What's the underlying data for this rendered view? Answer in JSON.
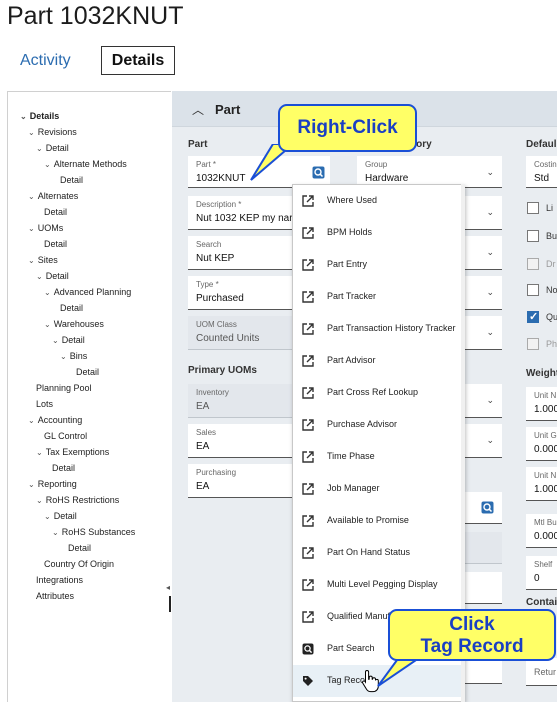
{
  "header": {
    "title": "Part 1032KNUT"
  },
  "tabs": [
    {
      "label": "Activity"
    },
    {
      "label": "Details"
    }
  ],
  "tree": [
    {
      "label": "Details"
    },
    {
      "label": "Revisions"
    },
    {
      "label": "Detail"
    },
    {
      "label": "Alternate Methods"
    },
    {
      "label": "Detail"
    },
    {
      "label": "Alternates"
    },
    {
      "label": "Detail"
    },
    {
      "label": "UOMs"
    },
    {
      "label": "Detail"
    },
    {
      "label": "Sites"
    },
    {
      "label": "Detail"
    },
    {
      "label": "Advanced Planning"
    },
    {
      "label": "Detail"
    },
    {
      "label": "Warehouses"
    },
    {
      "label": "Detail"
    },
    {
      "label": "Bins"
    },
    {
      "label": "Detail"
    },
    {
      "label": "Planning Pool"
    },
    {
      "label": "Lots"
    },
    {
      "label": "Accounting"
    },
    {
      "label": "GL Control"
    },
    {
      "label": "Tax Exemptions"
    },
    {
      "label": "Detail"
    },
    {
      "label": "Reporting"
    },
    {
      "label": "RoHS Restrictions"
    },
    {
      "label": "Detail"
    },
    {
      "label": "RoHS Substances"
    },
    {
      "label": "Detail"
    },
    {
      "label": "Country Of Origin"
    },
    {
      "label": "Integrations"
    },
    {
      "label": "Attributes"
    }
  ],
  "section": {
    "title": "Part",
    "part_group": "Part",
    "category_group": "gory",
    "defaults_group": "Defaul",
    "primary_uoms_group": "Primary UOMs",
    "weight_group": "Weight",
    "container_group": "Contai"
  },
  "fields": {
    "part": {
      "label": "Part *",
      "value": "1032KNUT"
    },
    "description": {
      "label": "Description *",
      "value": "Nut 1032 KEP my nar"
    },
    "search": {
      "label": "Search",
      "value": "Nut KEP"
    },
    "type": {
      "label": "Type *",
      "value": "Purchased"
    },
    "uom_class": {
      "label": "UOM Class",
      "value": "Counted Units"
    },
    "inventory": {
      "label": "Inventory",
      "value": "EA"
    },
    "sales": {
      "label": "Sales",
      "value": "EA"
    },
    "purchasing": {
      "label": "Purchasing",
      "value": "EA"
    },
    "group": {
      "label": "Group",
      "value": "Hardware"
    },
    "costing": {
      "label": "Costin",
      "value": "Std"
    },
    "unit1": {
      "label": "Unit N",
      "value": "1.000"
    },
    "unit2": {
      "label": "Unit G",
      "value": "0.000"
    },
    "unit3": {
      "label": "Unit N",
      "value": "1.000"
    },
    "mtl_bu": {
      "label": "Mtl Bu",
      "value": "0.000"
    },
    "shelf": {
      "label": "Shelf",
      "value": "0"
    },
    "return": {
      "label": "Retur",
      "value": ""
    }
  },
  "checkboxes": [
    {
      "label": "Li",
      "checked": false,
      "disabled": false
    },
    {
      "label": "Bu",
      "checked": false,
      "disabled": false
    },
    {
      "label": "Dr",
      "checked": false,
      "disabled": true
    },
    {
      "label": "No",
      "checked": false,
      "disabled": false
    },
    {
      "label": "Qu",
      "checked": true,
      "disabled": false
    },
    {
      "label": "Ph",
      "checked": false,
      "disabled": true
    }
  ],
  "context_menu": [
    {
      "label": "Where Used",
      "icon": "external-link-icon"
    },
    {
      "label": "BPM Holds",
      "icon": "external-link-icon"
    },
    {
      "label": "Part Entry",
      "icon": "external-link-icon"
    },
    {
      "label": "Part Tracker",
      "icon": "external-link-icon"
    },
    {
      "label": "Part Transaction History Tracker",
      "icon": "external-link-icon"
    },
    {
      "label": "Part Advisor",
      "icon": "external-link-icon"
    },
    {
      "label": "Part Cross Ref Lookup",
      "icon": "external-link-icon"
    },
    {
      "label": "Purchase Advisor",
      "icon": "external-link-icon"
    },
    {
      "label": "Time Phase",
      "icon": "external-link-icon"
    },
    {
      "label": "Job Manager",
      "icon": "external-link-icon"
    },
    {
      "label": "Available to Promise",
      "icon": "external-link-icon"
    },
    {
      "label": "Part On Hand Status",
      "icon": "external-link-icon"
    },
    {
      "label": "Multi Level Pegging Display",
      "icon": "external-link-icon"
    },
    {
      "label": "Qualified Manufa",
      "icon": "external-link-icon"
    },
    {
      "label": "Part Search",
      "icon": "search-icon"
    },
    {
      "label": "Tag Reco",
      "icon": "tag-icon"
    }
  ],
  "callouts": {
    "right_click": "Right-Click",
    "click_line1": "Click",
    "click_line2": "Tag Record"
  },
  "colors": {
    "accent": "#2b6cb0",
    "callout_fill": "#ffff66",
    "callout_border": "#1a4fd6"
  }
}
